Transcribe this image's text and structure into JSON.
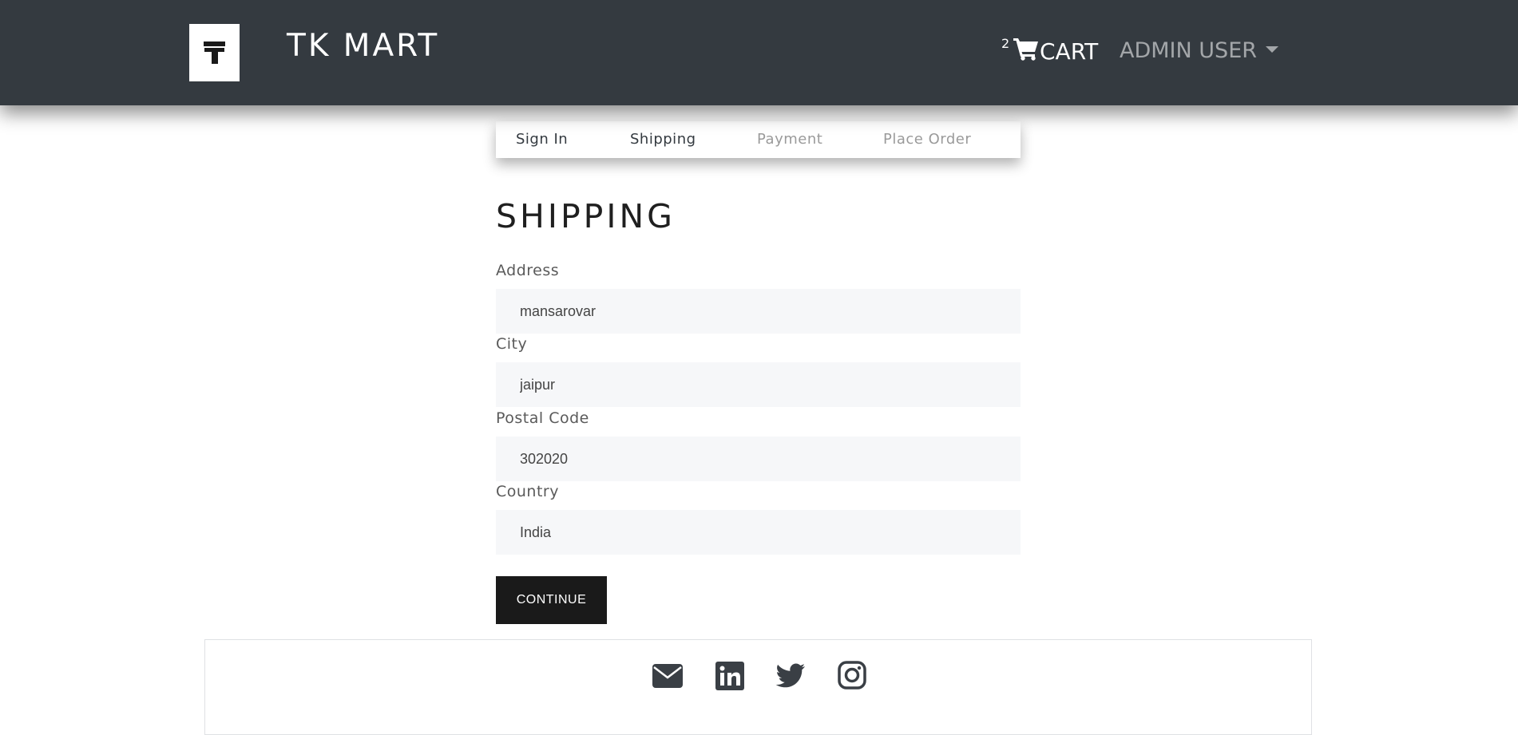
{
  "header": {
    "brand": "TK MART",
    "logo_icon": "tk-logo-icon",
    "cart": {
      "count": "2",
      "label": "CART",
      "icon": "shopping-cart-icon"
    },
    "user_menu": {
      "label": "ADMIN USER",
      "icon": "caret-down-icon"
    }
  },
  "steps": [
    {
      "label": "Sign In",
      "state": "active"
    },
    {
      "label": "Shipping",
      "state": "active"
    },
    {
      "label": "Payment",
      "state": "disabled"
    },
    {
      "label": "Place Order",
      "state": "disabled"
    }
  ],
  "form": {
    "title": "SHIPPING",
    "fields": {
      "address": {
        "label": "Address",
        "value": "mansarovar"
      },
      "city": {
        "label": "City",
        "value": "jaipur"
      },
      "postal_code": {
        "label": "Postal Code",
        "value": "302020"
      },
      "country": {
        "label": "Country",
        "value": "India"
      }
    },
    "submit_label": "CONTINUE"
  },
  "footer": {
    "social_icons": [
      "envelope-icon",
      "linkedin-icon",
      "twitter-icon",
      "instagram-icon"
    ]
  },
  "colors": {
    "navbar": "#343a40",
    "input_background": "#f6f7f9",
    "button": "#1a1a1a",
    "social_icon": "#3a3f45"
  }
}
